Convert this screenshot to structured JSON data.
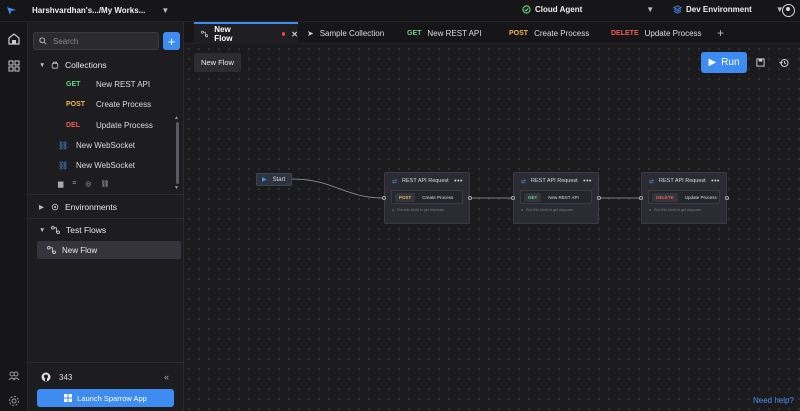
{
  "topbar": {
    "workspace_title": "Harshvardhan's.../My Works...",
    "agent_label": "Cloud Agent",
    "environment_label": "Dev Environment"
  },
  "sidebar": {
    "search_placeholder": "Search",
    "collections_label": "Collections",
    "collection_items": [
      {
        "method": "GET",
        "name": "New REST API"
      },
      {
        "method": "POST",
        "name": "Create Process"
      },
      {
        "method": "DEL",
        "name": "Update Process"
      }
    ],
    "websockets": [
      "New WebSocket",
      "New WebSocket"
    ],
    "environments_label": "Environments",
    "test_flows_label": "Test Flows",
    "test_flow_item": "New Flow",
    "github_stars": "343",
    "launch_label": "Launch Sparrow App"
  },
  "tabs": [
    {
      "label": "New Flow",
      "active": true
    },
    {
      "label": "Sample Collection"
    },
    {
      "method": "GET",
      "label": "New REST API"
    },
    {
      "method": "POST",
      "label": "Create Process"
    },
    {
      "method": "DELETE",
      "label": "Update Process"
    }
  ],
  "canvas": {
    "flow_name": "New Flow",
    "run_label": "Run",
    "start_label": "Start",
    "nodes": [
      {
        "title": "REST API Request",
        "method": "POST",
        "endpoint": "Create Process",
        "footer": "Run this block to get response"
      },
      {
        "title": "REST API Request",
        "method": "GET",
        "endpoint": "New REST API",
        "footer": "Run this block to get response"
      },
      {
        "title": "REST API Request",
        "method": "DELETE",
        "endpoint": "Update Process",
        "footer": "Run this block to get response"
      }
    ],
    "help_label": "Need help?"
  },
  "colors": {
    "accent": "#3e8bf2",
    "get": "#69d38a",
    "post": "#f0b64b",
    "delete": "#ee5b5b",
    "unsaved_dot": "#e24b4b"
  },
  "icons": [
    "sparrow-logo-icon",
    "check-circle-icon",
    "layers-icon",
    "user-icon",
    "home-icon",
    "grid-icon",
    "search-icon",
    "plus-icon",
    "folder-icon",
    "websocket-icon",
    "settings-icon",
    "flow-icon",
    "github-icon",
    "windows-icon",
    "play-icon",
    "save-icon",
    "history-icon",
    "swap-icon",
    "more-icon"
  ]
}
